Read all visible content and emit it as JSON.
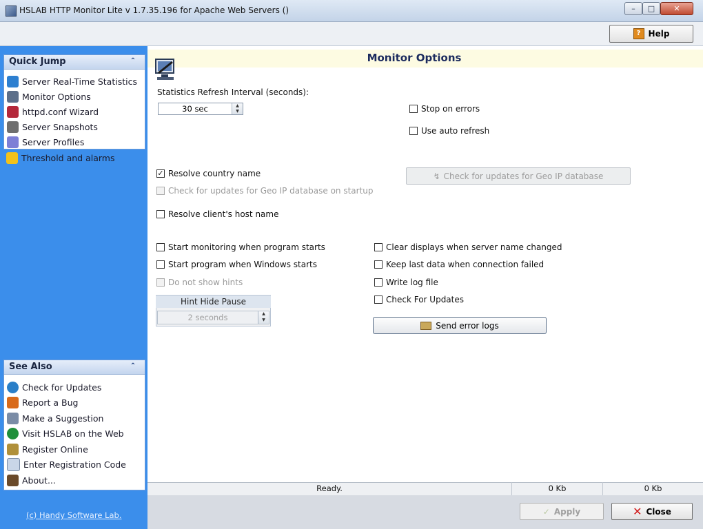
{
  "window": {
    "title": "HSLAB HTTP Monitor Lite v 1.7.35.196 for Apache Web Servers ()",
    "controls": {
      "minimize": "–",
      "maximize": "□",
      "close": "✕"
    }
  },
  "toolbar": {
    "help_label": "Help",
    "help_glyph": "?"
  },
  "quick_jump": {
    "title": "Quick Jump",
    "items": [
      {
        "label": "Server Real-Time Statistics",
        "icon": "chart-icon",
        "color": "#2d7fd0"
      },
      {
        "label": "Monitor Options",
        "icon": "monitor-options-icon",
        "color": "#5c6f8a"
      },
      {
        "label": "httpd.conf Wizard",
        "icon": "wizard-icon",
        "color": "#b4283a"
      },
      {
        "label": "Server Snapshots",
        "icon": "snapshot-icon",
        "color": "#6f6f6f"
      },
      {
        "label": "Server Profiles",
        "icon": "profiles-icon",
        "color": "#7d7fd6"
      },
      {
        "label": "Threshold and alarms",
        "icon": "warning-icon",
        "color": "#f2c21a"
      }
    ]
  },
  "see_also": {
    "title": "See Also",
    "items": [
      {
        "label": "Check for Updates",
        "icon": "update-icon",
        "color": "#2a7fc8"
      },
      {
        "label": "Report a Bug",
        "icon": "bug-icon",
        "color": "#d86a1a"
      },
      {
        "label": "Make a Suggestion",
        "icon": "suggestion-icon",
        "color": "#7a8ca6"
      },
      {
        "label": "Visit HSLAB on the Web",
        "icon": "globe-icon",
        "color": "#1f8f3a"
      },
      {
        "label": "Register Online",
        "icon": "register-icon",
        "color": "#b0903a"
      },
      {
        "label": "Enter Registration Code",
        "icon": "document-icon",
        "color": "#c9d6e8"
      },
      {
        "label": "About...",
        "icon": "about-icon",
        "color": "#6a4a2a"
      }
    ]
  },
  "copyright": "(c) Handy Software Lab.",
  "main": {
    "title": "Monitor Options",
    "refresh_label": "Statistics Refresh Interval (seconds):",
    "refresh_value": "30 sec",
    "options": {
      "stop_on_errors": {
        "label": "Stop on errors",
        "checked": false
      },
      "use_auto_refresh": {
        "label": "Use auto refresh",
        "checked": false
      },
      "resolve_country": {
        "label": "Resolve country name",
        "checked": true
      },
      "geo_ip_startup": {
        "label": "Check for updates for Geo IP database on startup",
        "checked": false,
        "disabled": true
      },
      "resolve_host": {
        "label": "Resolve client's host name",
        "checked": false
      },
      "start_monitoring": {
        "label": "Start monitoring when program starts",
        "checked": false
      },
      "start_with_windows": {
        "label": "Start program when Windows starts",
        "checked": false
      },
      "do_not_show_hints": {
        "label": "Do not show hints",
        "checked": false,
        "disabled": true
      },
      "clear_displays": {
        "label": "Clear displays when server name changed",
        "checked": false
      },
      "keep_last_data": {
        "label": "Keep last data when connection failed",
        "checked": false
      },
      "write_log": {
        "label": "Write log file",
        "checked": false
      },
      "check_updates": {
        "label": "Check For Updates",
        "checked": false
      }
    },
    "geo_update_button": "Check for updates for Geo IP database",
    "hint_hide": {
      "title": "Hint Hide Pause",
      "value": "2 seconds"
    },
    "send_error_logs_button": "Send error logs"
  },
  "status": {
    "text": "Ready.",
    "received": "0 Kb",
    "sent": "0 Kb"
  },
  "footer": {
    "apply_label": "Apply",
    "close_label": "Close"
  },
  "colors": {
    "sidebar": "#3b8eeb",
    "header_bg": "#fdfbe2",
    "title_text": "#1c2b5e"
  }
}
